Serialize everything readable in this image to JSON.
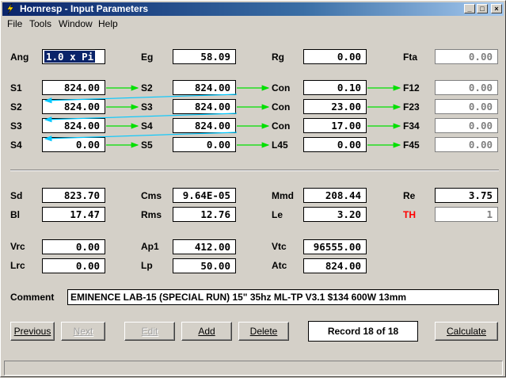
{
  "window": {
    "title": "Hornresp - Input Parameters",
    "minimize": "_",
    "maximize": "□",
    "close": "×"
  },
  "menu": {
    "file": "File",
    "tools": "Tools",
    "window": "Window",
    "help": "Help"
  },
  "row_ang": {
    "ang_label": "Ang",
    "ang_value": "1.0 x Pi",
    "eg_label": "Eg",
    "eg_value": "58.09",
    "rg_label": "Rg",
    "rg_value": "0.00",
    "fta_label": "Fta",
    "fta_value": "0.00"
  },
  "segments": [
    {
      "s_left": "S1",
      "s_left_val": "824.00",
      "s_right": "S2",
      "s_right_val": "824.00",
      "type": "Con",
      "type_val": "0.10",
      "f_label": "F12",
      "f_val": "0.00"
    },
    {
      "s_left": "S2",
      "s_left_val": "824.00",
      "s_right": "S3",
      "s_right_val": "824.00",
      "type": "Con",
      "type_val": "23.00",
      "f_label": "F23",
      "f_val": "0.00"
    },
    {
      "s_left": "S3",
      "s_left_val": "824.00",
      "s_right": "S4",
      "s_right_val": "824.00",
      "type": "Con",
      "type_val": "17.00",
      "f_label": "F34",
      "f_val": "0.00"
    },
    {
      "s_left": "S4",
      "s_left_val": "0.00",
      "s_right": "S5",
      "s_right_val": "0.00",
      "type": "L45",
      "type_val": "0.00",
      "f_label": "F45",
      "f_val": "0.00"
    }
  ],
  "driver": {
    "sd_label": "Sd",
    "sd_value": "823.70",
    "cms_label": "Cms",
    "cms_value": "9.64E-05",
    "mmd_label": "Mmd",
    "mmd_value": "208.44",
    "re_label": "Re",
    "re_value": "3.75",
    "bl_label": "Bl",
    "bl_value": "17.47",
    "rms_label": "Rms",
    "rms_value": "12.76",
    "le_label": "Le",
    "le_value": "3.20",
    "th_label": "TH",
    "th_value": "1"
  },
  "chamber": {
    "vrc_label": "Vrc",
    "vrc_value": "0.00",
    "ap1_label": "Ap1",
    "ap1_value": "412.00",
    "vtc_label": "Vtc",
    "vtc_value": "96555.00",
    "lrc_label": "Lrc",
    "lrc_value": "0.00",
    "lp_label": "Lp",
    "lp_value": "50.00",
    "atc_label": "Atc",
    "atc_value": "824.00"
  },
  "comment": {
    "label": "Comment",
    "value": "EMINENCE LAB-15 (SPECIAL RUN) 15\" 35hz ML-TP V3.1 $134 600W 13mm"
  },
  "buttons": {
    "previous": "Previous",
    "next": "Next",
    "edit": "Edit",
    "add": "Add",
    "delete": "Delete",
    "calculate": "Calculate"
  },
  "record": "Record 18 of 18",
  "colors": {
    "arrow": "#00e000",
    "link": "#00c8ff",
    "title_start": "#0a246a",
    "th_label": "#ff0000"
  }
}
